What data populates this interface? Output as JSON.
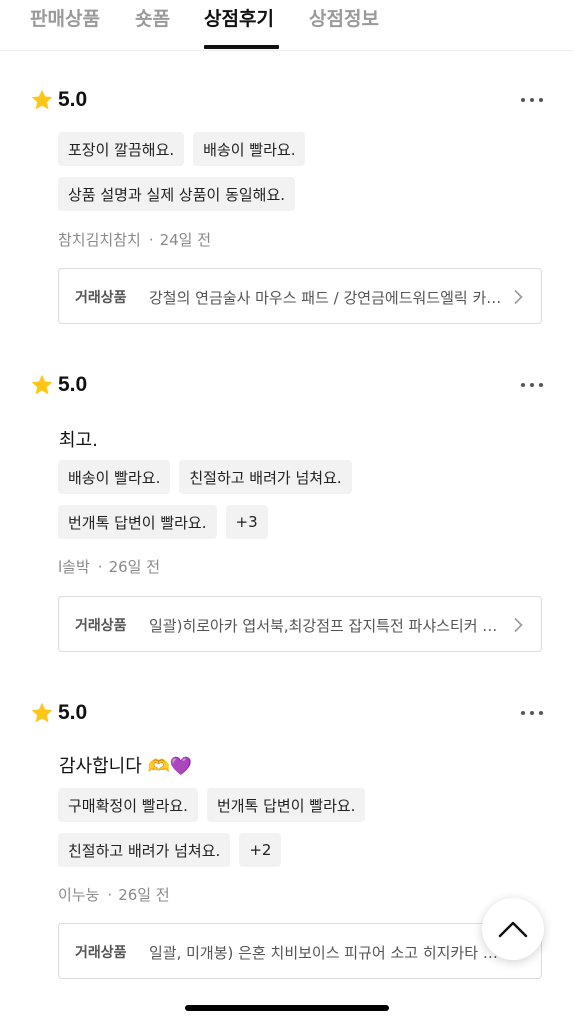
{
  "tabs": [
    {
      "label": "판매상품"
    },
    {
      "label": "숏폼"
    },
    {
      "label": "상점후기",
      "active": true
    },
    {
      "label": "상점정보"
    }
  ],
  "reviews": [
    {
      "score": "5.0",
      "comment": "",
      "chip_rows": [
        [
          "포장이 깔끔해요.",
          "배송이 빨라요."
        ],
        [
          "상품 설명과 실제 상품이 동일해요."
        ]
      ],
      "author": "참치김치참치",
      "time": "24일 전",
      "product_label": "거래상품",
      "product_title": "강철의 연금술사 마우스 패드 / 강연금에드워드엘릭 카드케이스"
    },
    {
      "score": "5.0",
      "comment": "최고.",
      "chip_rows": [
        [
          "배송이 빨라요.",
          "친절하고 배려가 넘쳐요."
        ],
        [
          "번개톡 답변이 빨라요.",
          "+3"
        ]
      ],
      "author": "l솔박",
      "time": "26일 전",
      "product_label": "거래상품",
      "product_title": "일괄)히로아카 엽서북,최강점프 잡지특전 파샤스티커 세트"
    },
    {
      "score": "5.0",
      "comment": "감사합니다 🫶💜",
      "chip_rows": [
        [
          "구매확정이 빨라요.",
          "번개톡 답변이 빨라요."
        ],
        [
          "친절하고 배려가 넘쳐요.",
          "+2"
        ]
      ],
      "author": "이누눙",
      "time": "26일 전",
      "product_label": "거래상품",
      "product_title": "일괄, 미개봉) 은혼 치비보이스 피규어 소고 히지카타 긴토키"
    }
  ],
  "colors": {
    "star": "#FFC61A",
    "active_tab": "#111111",
    "inactive_tab": "#9a9a9a"
  },
  "icons": {
    "rating": "star-icon",
    "more": "more-dots-icon",
    "product": "chevron-right-icon",
    "scroll_top": "chevron-up-icon"
  }
}
